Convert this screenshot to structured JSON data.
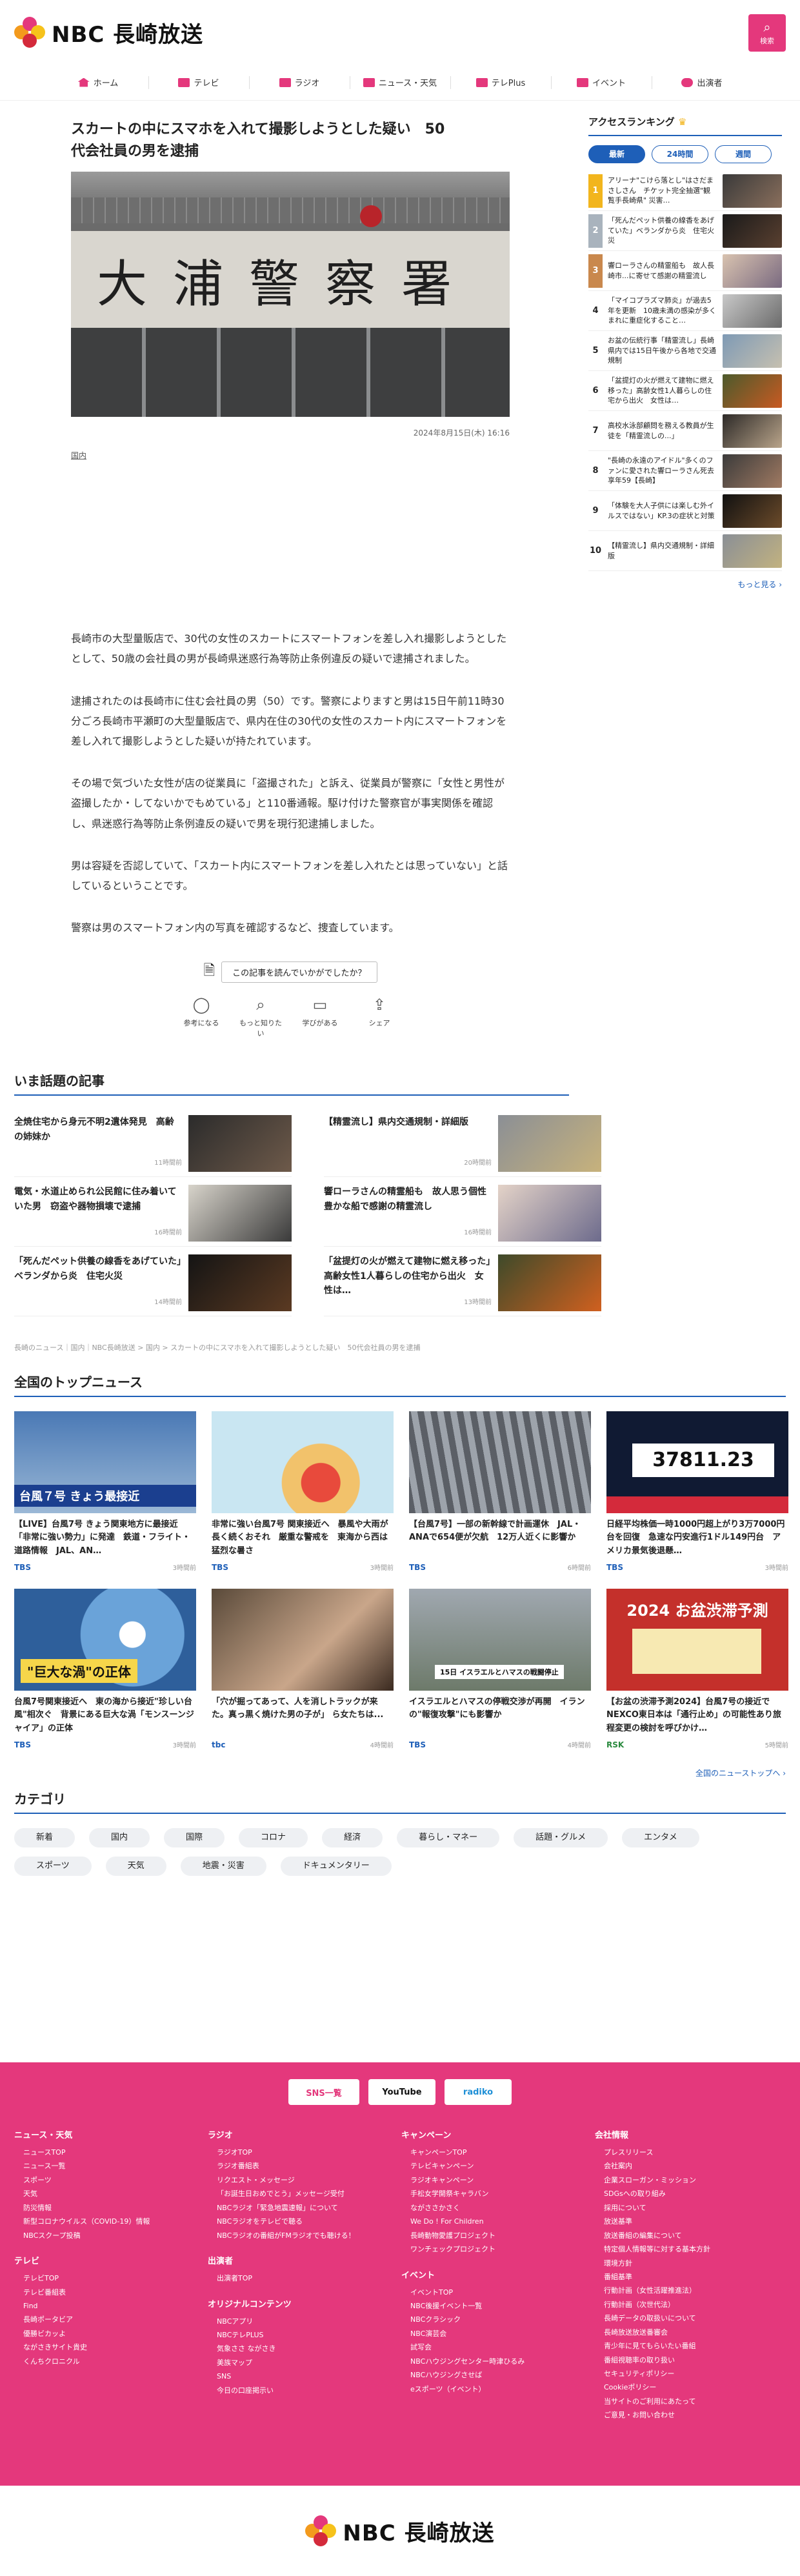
{
  "header": {
    "brand": "NBC 長崎放送",
    "search_label": "検索"
  },
  "nav": [
    {
      "label": "ホーム"
    },
    {
      "label": "テレビ"
    },
    {
      "label": "ラジオ"
    },
    {
      "label": "ニュース・天気"
    },
    {
      "label": "テレPlus"
    },
    {
      "label": "イベント"
    },
    {
      "label": "出演者"
    }
  ],
  "article": {
    "headline": "スカートの中にスマホを入れて撮影しようとした疑い　50代会社員の男を逮捕",
    "hero_sign": "大浦警察署",
    "date": "2024年8月15日(木) 16:16",
    "tag": "国内",
    "paragraphs": [
      "長崎市の大型量販店で、30代の女性のスカートにスマートフォンを差し入れ撮影しようとしたとして、50歳の会社員の男が長崎県迷惑行為等防止条例違反の疑いで逮捕されました。",
      "逮捕されたのは長崎市に住む会社員の男（50）です。警察によりますと男は15日午前11時30分ごろ長崎市平瀬町の大型量販店で、県内在住の30代の女性のスカート内にスマートフォンを差し入れて撮影しようとした疑いが持たれています。",
      "その場で気づいた女性が店の従業員に「盗撮された」と訴え、従業員が警察に「女性と男性が盗撮したか・してないかでもめている」と110番通報。駆け付けた警察官が事実関係を確認し、県迷惑行為等防止条例違反の疑いで男を現行犯逮捕しました。",
      "男は容疑を否認していて、「スカート内にスマートフォンを差し入れたとは思っていない」と話しているということです。",
      "警察は男のスマートフォン内の写真を確認するなど、捜査しています。"
    ],
    "feedback_question": "この記事を読んでいかがでしたか？",
    "feedback_options": [
      "参考になる",
      "もっと知りたい",
      "学びがある",
      "シェア"
    ]
  },
  "ranking": {
    "title": "アクセスランキング",
    "tabs": [
      "最新",
      "24時間",
      "週間"
    ],
    "items": [
      {
        "rank": "1",
        "text": "アリーナ\"こけら落とし\"はさだまさしさん　チケット完全抽選\"観覧手長崎県\" 災害…"
      },
      {
        "rank": "2",
        "text": "「死んだペット供養の線香をあげていた」ベランダから炎　住宅火災"
      },
      {
        "rank": "3",
        "text": "響ローラさんの精霊船も　故人長崎市...に寄せて感謝の精霊流し"
      },
      {
        "rank": "4",
        "text": "「マイコプラズマ肺炎」が過去5年を更新　10歳未満の感染が多くまれに重症化すること…"
      },
      {
        "rank": "5",
        "text": "お盆の伝統行事「精霊流し」長崎県内では15日午後から各地で交通規制"
      },
      {
        "rank": "6",
        "text": "「盆提灯の火が燃えて建物に燃え移った」高齢女性1人暮らしの住宅から出火　女性は…"
      },
      {
        "rank": "7",
        "text": "高校水泳部顧問を務える教員が生徒を「精霊流しの...」"
      },
      {
        "rank": "8",
        "text": "\"長崎の永遠のアイドル\"多くのファンに愛された響ローラさん死去　享年59【長崎】"
      },
      {
        "rank": "9",
        "text": "「体験を大人子供には楽しむ外イルスではない」KP.3の症状と対策"
      },
      {
        "rank": "10",
        "text": "【精霊流し】県内交通規制・詳細版"
      }
    ],
    "more": "もっと見る ›"
  },
  "hot": {
    "title": "いま話題の記事",
    "items": [
      {
        "text": "全焼住宅から身元不明2遺体発見　高齢の姉妹か",
        "time": "11時間前"
      },
      {
        "text": "【精霊流し】県内交通規制・詳細版",
        "time": "20時間前"
      },
      {
        "text": "電気・水道止められ公民館に住み着いていた男　窃盗や器物損壊で逮捕",
        "time": "16時間前"
      },
      {
        "text": "響ローラさんの精霊船も　故人思う個性豊かな船で感謝の精霊流し",
        "time": "16時間前"
      },
      {
        "text": "「死んだペット供養の線香をあげていた」ベランダから炎　住宅火災",
        "time": "14時間前"
      },
      {
        "text": "「盆提灯の火が燃えて建物に燃え移った」高齢女性1人暮らしの住宅から出火　女性は…",
        "time": "13時間前"
      }
    ]
  },
  "breadcrumb": "長崎のニュース｜国内｜NBC長崎放送 > 国内 > スカートの中にスマホを入れて撮影しようとした疑い　50代会社員の男を逮捕",
  "topnews": {
    "title": "全国のトップニュース",
    "items": [
      {
        "title": "【LIVE】台風7号 きょう関東地方に最接近 「非常に強い勢力」に発達　鉄道・フライト・道路情報　JAL、AN…",
        "src": "TBS",
        "time": "3時間前",
        "overlay": "台風７号 きょう最接近"
      },
      {
        "title": "非常に強い台風7号 関東接近へ　暴風や大雨が長く続くおそれ　厳重な警戒を　東海から西は猛烈な暑さ",
        "src": "TBS",
        "time": "3時間前",
        "overlay": ""
      },
      {
        "title": "【台風7号】一部の新幹線で計画運休　JAL・ANAで654便が欠航　12万人近くに影響か",
        "src": "TBS",
        "time": "6時間前",
        "overlay": ""
      },
      {
        "title": "日経平均株価一時1000円超上がり3万7000円台を回復　急速な円安進行1ドル149円台　アメリカ景気後退懸…",
        "src": "TBS",
        "time": "3時間前",
        "overlay": "37811.23"
      },
      {
        "title": "台風7号関東接近へ　東の海から接近\"珍しい台風\"相次ぐ　背景にある巨大な渦「モンスーンジャイア」の正体",
        "src": "TBS",
        "time": "3時間前",
        "overlay": "\"巨大な渦\"の正体"
      },
      {
        "title": "「穴が掘ってあって、人を消しトラックが来た。真っ黒く焼けた男の子が」 ら女たちは...",
        "src": "tbc",
        "time": "4時間前",
        "overlay": ""
      },
      {
        "title": "イスラエルとハマスの停戦交渉が再開　イランの\"報復攻撃\"にも影響か",
        "src": "TBS",
        "time": "4時間前",
        "overlay": "15日 イスラエルとハマスの戦闘停止"
      },
      {
        "title": "【お盆の渋滞予測2024】台風7号の接近でNEXCO東日本は「通行止め」の可能性あり旅程変更の検討を呼びかけ…",
        "src": "RSK",
        "time": "5時間前",
        "overlay": "2024 お盆渋滞予測"
      }
    ],
    "more": "全国のニューストップへ ›"
  },
  "category": {
    "title": "カテゴリ",
    "items": [
      "新着",
      "国内",
      "国際",
      "コロナ",
      "経済",
      "暮らし・マネー",
      "話題・グルメ",
      "エンタメ",
      "スポーツ",
      "天気",
      "地震・災害",
      "ドキュメンタリー"
    ]
  },
  "footer": {
    "sns": [
      "SNS一覧",
      "YouTube",
      "radiko"
    ],
    "cols": [
      {
        "groups": [
          {
            "head": "ニュース・天気",
            "links": [
              "ニュースTOP",
              "ニュース一覧",
              "スポーツ",
              "天気",
              "防災情報",
              "新型コロナウイルス（COVID-19）情報",
              "NBCスクープ投稿"
            ]
          },
          {
            "head": "テレビ",
            "links": [
              "テレビTOP",
              "テレビ番組表",
              "Find",
              "長崎ポータビア",
              "優勝ビカッよ",
              "ながさきサイト貴史",
              "くんちクロニクル"
            ]
          }
        ]
      },
      {
        "groups": [
          {
            "head": "ラジオ",
            "links": [
              "ラジオTOP",
              "ラジオ番組表",
              "リクエスト・メッセージ",
              "「お誕生日おめでとう」メッセージ受付",
              "NBCラジオ「緊急地震速報」について",
              "NBCラジオをテレビで聴る",
              "NBCラジオの番組がFMラジオでも聴ける！"
            ]
          },
          {
            "head": "出演者",
            "links": [
              "出演者TOP"
            ]
          },
          {
            "head": "オリジナルコンテンツ",
            "links": [
              "NBCアプリ",
              "NBCテレPLUS",
              "気象ささ ながさき",
              "美族マップ",
              "SNS",
              "今日の口座掲示い"
            ]
          }
        ]
      },
      {
        "groups": [
          {
            "head": "キャンペーン",
            "links": [
              "キャンペーンTOP",
              "テレビキャンペーン",
              "ラジオキャンペーン",
              "手松女学開祭キャラバン",
              "ながささかさく",
              "We Do ! For Children",
              "長崎動物愛護プロジェクト",
              "ワンチェックプロジェクト"
            ]
          },
          {
            "head": "イベント",
            "links": [
              "イベントTOP",
              "NBC後援イベント一覧",
              "NBCクラシック",
              "NBC演芸会",
              "試写会",
              "NBCハウジングセンター時津ひるみ",
              "NBCハウジングさせば",
              "eスポーツ（イベント）"
            ]
          }
        ]
      },
      {
        "groups": [
          {
            "head": "会社情報",
            "links": [
              "プレスリリース",
              "会社案内",
              "企業スローガン・ミッション",
              "SDGsへの取り組み",
              "採用について",
              "放送基準",
              "放送番組の編集について",
              "特定個人情報等に対する基本方針",
              "環境方針",
              "番組基準",
              "行動計画（女性活躍推進法）",
              "行動計画（次世代法）",
              "長崎データの取扱いについて",
              "長崎放送放送番審会",
              "青少年に見てもらいたい番組",
              "番組視聴率の取り扱い",
              "セキュリティポリシー",
              "Cookieポリシー",
              "当サイトのご利用にあたって",
              "ご意見・お問い合わせ"
            ]
          }
        ]
      }
    ],
    "brand": "NBC 長崎放送"
  }
}
